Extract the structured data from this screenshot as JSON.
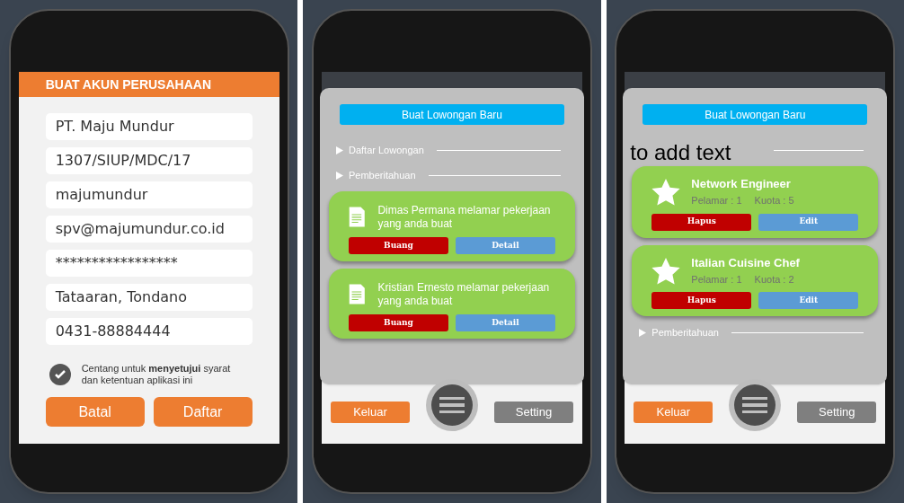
{
  "screens": [
    {
      "kind": "register",
      "title": "BUAT AKUN PERUSAHAAN",
      "fields": [
        {
          "value": "PT. Maju Mundur"
        },
        {
          "value": "1307/SIUP/MDC/17"
        },
        {
          "value": "majumundur"
        },
        {
          "value": "spv@majumundur.co.id"
        },
        {
          "value": "*****************"
        },
        {
          "value": "Tataaran, Tondano"
        },
        {
          "value": "0431-88884444"
        }
      ],
      "agreement": {
        "checked": true,
        "text": "Centang untuk **menyetujui** syarat dan ketentuan aplikasi ini"
      },
      "buttons": [
        "Batal",
        "Daftar"
      ]
    },
    {
      "kind": "dashboard",
      "create_button": "Buat Lowongan Baru",
      "items": [
        {
          "kind": "section",
          "label": "Daftar Lowongan"
        },
        {
          "kind": "section",
          "label": "Pemberitahuan"
        },
        {
          "kind": "notification",
          "text": "Dimas Permana melamar pekerjaan yang anda buat",
          "buttons": [
            "Buang",
            "Detail"
          ]
        },
        {
          "kind": "notification",
          "text": "Kristian Ernesto melamar pekerjaan yang anda buat",
          "buttons": [
            "Buang",
            "Detail"
          ]
        }
      ],
      "footer": {
        "logout": "Keluar",
        "settings": "Setting"
      }
    },
    {
      "kind": "dashboard",
      "create_button": "Buat Lowongan Baru",
      "overlay_text": "to add text",
      "items": [
        {
          "kind": "section_line"
        },
        {
          "kind": "job",
          "title": "Network Engineer",
          "applicants": "Pelamar : 1",
          "quota": "Kuota : 5",
          "buttons": [
            "Hapus",
            "Edit"
          ]
        },
        {
          "kind": "job",
          "title": "Italian Cuisine Chef",
          "applicants": "Pelamar : 1",
          "quota": "Kuota : 2",
          "buttons": [
            "Hapus",
            "Edit"
          ]
        },
        {
          "kind": "section",
          "label": "Pemberitahuan"
        }
      ],
      "footer": {
        "logout": "Keluar",
        "settings": "Setting"
      }
    }
  ]
}
